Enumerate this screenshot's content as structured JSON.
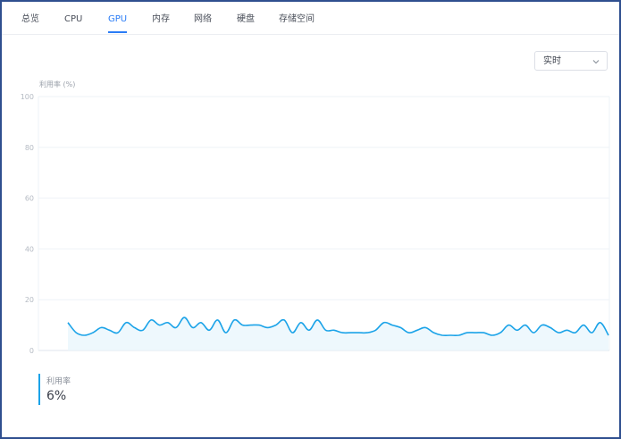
{
  "tabs": [
    {
      "label": "总览",
      "active": false
    },
    {
      "label": "CPU",
      "active": false
    },
    {
      "label": "GPU",
      "active": true
    },
    {
      "label": "内存",
      "active": false
    },
    {
      "label": "网络",
      "active": false
    },
    {
      "label": "硬盘",
      "active": false
    },
    {
      "label": "存储空间",
      "active": false
    }
  ],
  "range_select": {
    "value": "实时"
  },
  "colors": {
    "accent": "#2a7cf6",
    "series": "#1ba3e8",
    "fill": "#eaf6fd",
    "grid": "#eef3f7"
  },
  "chart_data": {
    "type": "area",
    "ylabel": "利用率 (%)",
    "ylim": [
      0,
      100
    ],
    "yticks": [
      0,
      20,
      40,
      60,
      80,
      100
    ],
    "grid": true,
    "series": [
      {
        "name": "利用率",
        "values": [
          11,
          7,
          6,
          7,
          9,
          8,
          7,
          11,
          9,
          8,
          12,
          10,
          11,
          9,
          13,
          9,
          11,
          8,
          12,
          7,
          12,
          10,
          10,
          10,
          9,
          10,
          12,
          7,
          11,
          8,
          12,
          8,
          8,
          7,
          7,
          7,
          7,
          8,
          11,
          10,
          9,
          7,
          8,
          9,
          7,
          6,
          6,
          6,
          7,
          7,
          7,
          6,
          7,
          10,
          8,
          10,
          7,
          10,
          9,
          7,
          8,
          7,
          10,
          7,
          11,
          6
        ]
      }
    ]
  },
  "legend": {
    "label": "利用率",
    "value": "6%"
  }
}
